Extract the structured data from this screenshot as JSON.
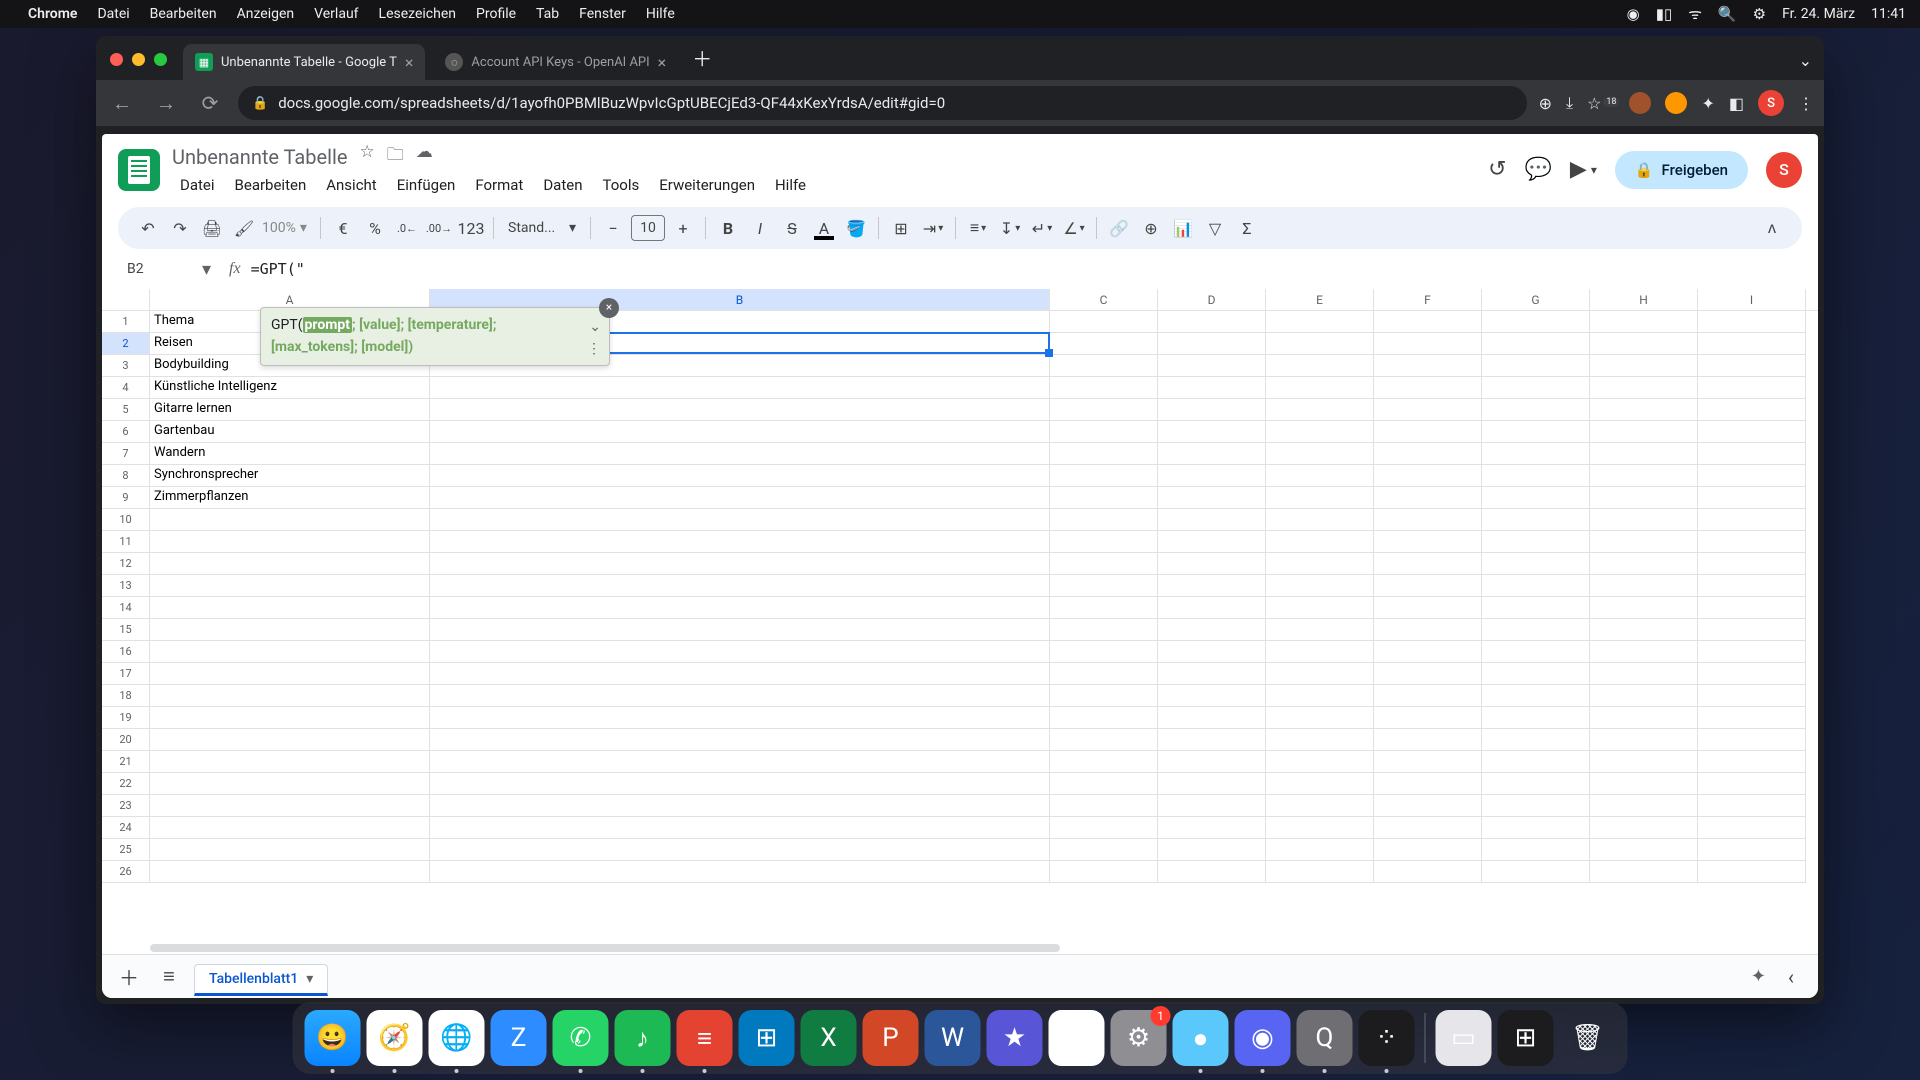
{
  "mac_menu": {
    "app_name": "Chrome",
    "items": [
      "Datei",
      "Bearbeiten",
      "Anzeigen",
      "Verlauf",
      "Lesezeichen",
      "Profile",
      "Tab",
      "Fenster",
      "Hilfe"
    ],
    "date": "Fr. 24. März",
    "time": "11:41"
  },
  "chrome": {
    "tabs": [
      {
        "title": "Unbenannte Tabelle - Google T",
        "active": true,
        "favicon": "sheets"
      },
      {
        "title": "Account API Keys - OpenAI API",
        "active": false,
        "favicon": "openai"
      }
    ],
    "url": "docs.google.com/spreadsheets/d/1ayofh0PBMlBuzWpvIcGptUBECjEd3-QF44xKexYrdsA/edit#gid=0",
    "ext_badge": "18",
    "avatar_letter": "S"
  },
  "sheets": {
    "doc_title": "Unbenannte Tabelle",
    "menus": [
      "Datei",
      "Bearbeiten",
      "Ansicht",
      "Einfügen",
      "Format",
      "Daten",
      "Tools",
      "Erweiterungen",
      "Hilfe"
    ],
    "share_label": "Freigeben",
    "avatar_letter": "S",
    "toolbar": {
      "zoom": "100%",
      "currency": "€",
      "percent": "%",
      "dec_dec": ".0←",
      "dec_inc": ".00→",
      "fmt123": "123",
      "font": "Stand...",
      "font_size": "10"
    },
    "name_box": "B2",
    "formula": "=GPT(\"",
    "tooltip": {
      "fn_name": "GPT",
      "param_highlight": "prompt",
      "params_rest_line1": "; [value]; [temperature];",
      "params_line2": "[max_tokens]; [model])"
    },
    "column_headers": [
      "A",
      "B",
      "C",
      "D",
      "E",
      "F",
      "G",
      "H",
      "I"
    ],
    "selected_col": "B",
    "selected_row": 2,
    "rows": [
      "Thema",
      "Reisen",
      "Bodybuilding",
      "Künstliche Intelligenz",
      "Gitarre lernen",
      "Gartenbau",
      "Wandern",
      "Synchronsprecher",
      "Zimmerpflanzen"
    ],
    "total_visible_rows": 26,
    "sheet_tab": "Tabellenblatt1"
  },
  "dock": {
    "apps": [
      {
        "name": "finder-icon",
        "bg": "linear-gradient(#2aa9ff,#0a84ff)",
        "glyph": "😀",
        "running": true
      },
      {
        "name": "safari-icon",
        "bg": "#fff",
        "glyph": "🧭",
        "running": true
      },
      {
        "name": "chrome-icon",
        "bg": "#fff",
        "glyph": "🌐",
        "running": true
      },
      {
        "name": "zoom-icon",
        "bg": "#2d8cff",
        "glyph": "Z",
        "running": false
      },
      {
        "name": "whatsapp-icon",
        "bg": "#25d366",
        "glyph": "✆",
        "running": true
      },
      {
        "name": "spotify-icon",
        "bg": "#1db954",
        "glyph": "♪",
        "running": true
      },
      {
        "name": "todoist-icon",
        "bg": "#e44332",
        "glyph": "≡",
        "running": true
      },
      {
        "name": "trello-icon",
        "bg": "#0079bf",
        "glyph": "⊞",
        "running": false
      },
      {
        "name": "excel-icon",
        "bg": "#107c41",
        "glyph": "X",
        "running": false
      },
      {
        "name": "powerpoint-icon",
        "bg": "#d24726",
        "glyph": "P",
        "running": false
      },
      {
        "name": "word-icon",
        "bg": "#2b579a",
        "glyph": "W",
        "running": false
      },
      {
        "name": "imovie-icon",
        "bg": "#5856d6",
        "glyph": "★",
        "running": false
      },
      {
        "name": "drive-icon",
        "bg": "#fff",
        "glyph": "△",
        "running": false
      },
      {
        "name": "settings-icon",
        "bg": "#8e8e93",
        "glyph": "⚙",
        "running": false,
        "badge": "1"
      },
      {
        "name": "app-teal-icon",
        "bg": "#5ac8fa",
        "glyph": "●",
        "running": true
      },
      {
        "name": "discord-icon",
        "bg": "#5865f2",
        "glyph": "◉",
        "running": true
      },
      {
        "name": "quicktime-icon",
        "bg": "#6e6e73",
        "glyph": "Q",
        "running": true
      },
      {
        "name": "voice-memos-icon",
        "bg": "#1c1c1e",
        "glyph": "⁘",
        "running": true
      }
    ],
    "right_apps": [
      {
        "name": "preview-window-icon",
        "bg": "#e5e5ea",
        "glyph": "▭"
      },
      {
        "name": "mission-control-icon",
        "bg": "#1c1c1e",
        "glyph": "⊞"
      },
      {
        "name": "trash-icon",
        "bg": "transparent",
        "glyph": "🗑"
      }
    ]
  }
}
